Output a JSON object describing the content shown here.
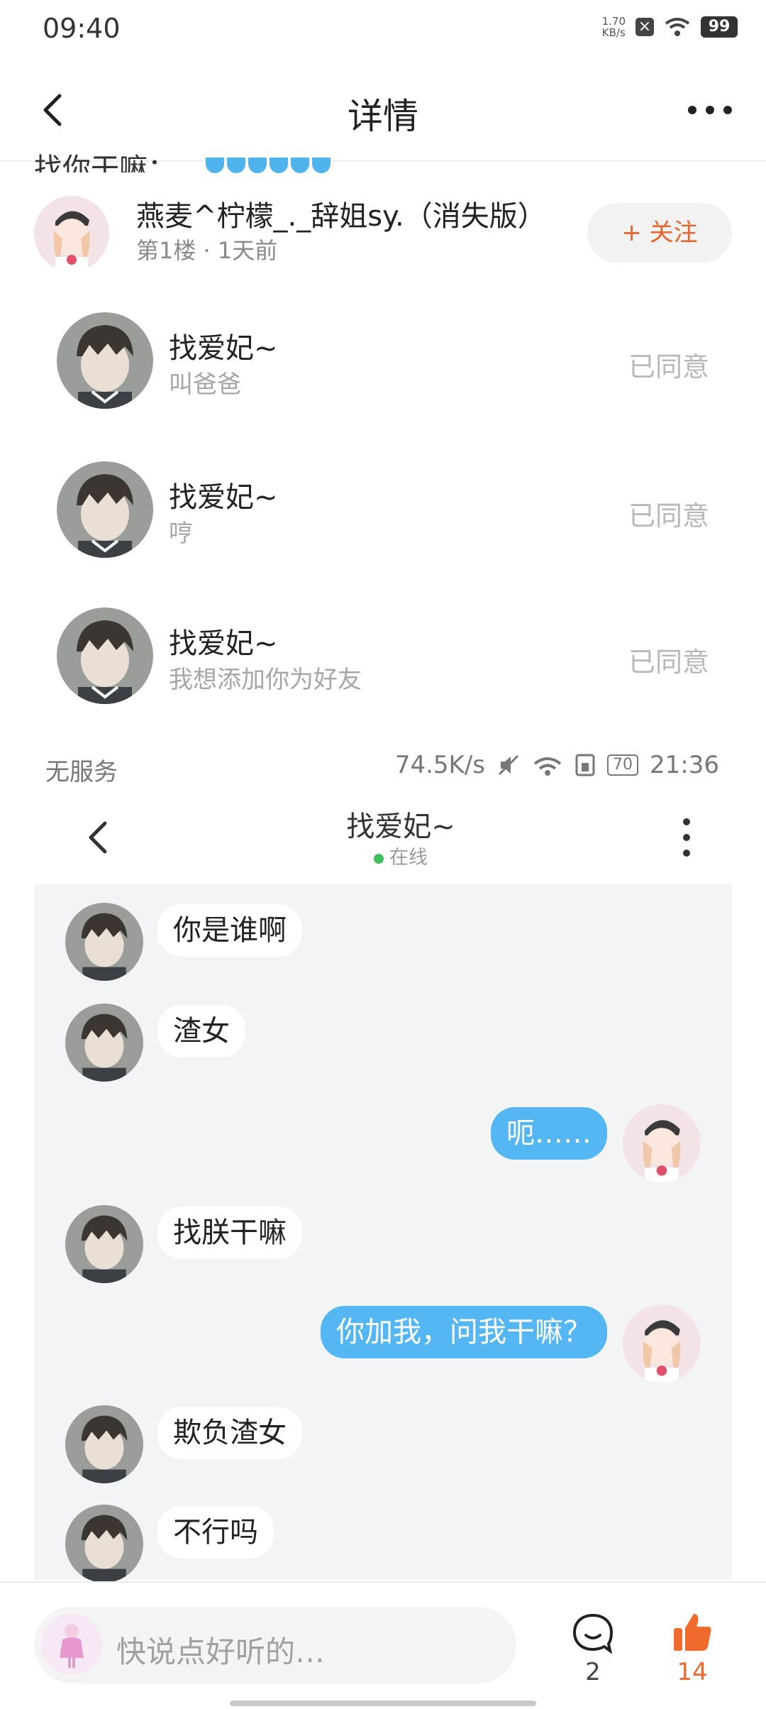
{
  "status_bar": {
    "time": "09:40",
    "speed": "1.70",
    "speed_unit": "KB/s",
    "battery": "99"
  },
  "header": {
    "title": "详情"
  },
  "post": {
    "snippet": "找你干嘛：",
    "author": "燕麦^柠檬_._辞姐sy.（消失版）",
    "meta": "第1楼 · 1天前",
    "follow_label": "+ 关注"
  },
  "requests": [
    {
      "name": "找爱妃~",
      "message": "叫爸爸",
      "status": "已同意"
    },
    {
      "name": "找爱妃~",
      "message": "哼",
      "status": "已同意"
    },
    {
      "name": "找爱妃~",
      "message": "我想添加你为好友",
      "status": "已同意"
    }
  ],
  "inner_status": {
    "carrier": "无服务",
    "speed": "74.5K/s",
    "battery": "70",
    "time": "21:36"
  },
  "inner_chat": {
    "title": "找爱妃~",
    "online": "在线",
    "messages": [
      {
        "side": "left",
        "text": "你是谁啊"
      },
      {
        "side": "left",
        "text": "渣女"
      },
      {
        "side": "right",
        "text": "呃……"
      },
      {
        "side": "left",
        "text": "找朕干嘛"
      },
      {
        "side": "right",
        "text": "你加我，问我干嘛？"
      },
      {
        "side": "left",
        "text": "欺负渣女"
      },
      {
        "side": "left",
        "text": "不行吗"
      }
    ]
  },
  "bottom_bar": {
    "placeholder": "快说点好听的…",
    "comment_count": "2",
    "like_count": "14"
  },
  "colors": {
    "accent": "#ef6a2c",
    "bubble_blue": "#54b7f4",
    "online": "#3bc05a"
  }
}
